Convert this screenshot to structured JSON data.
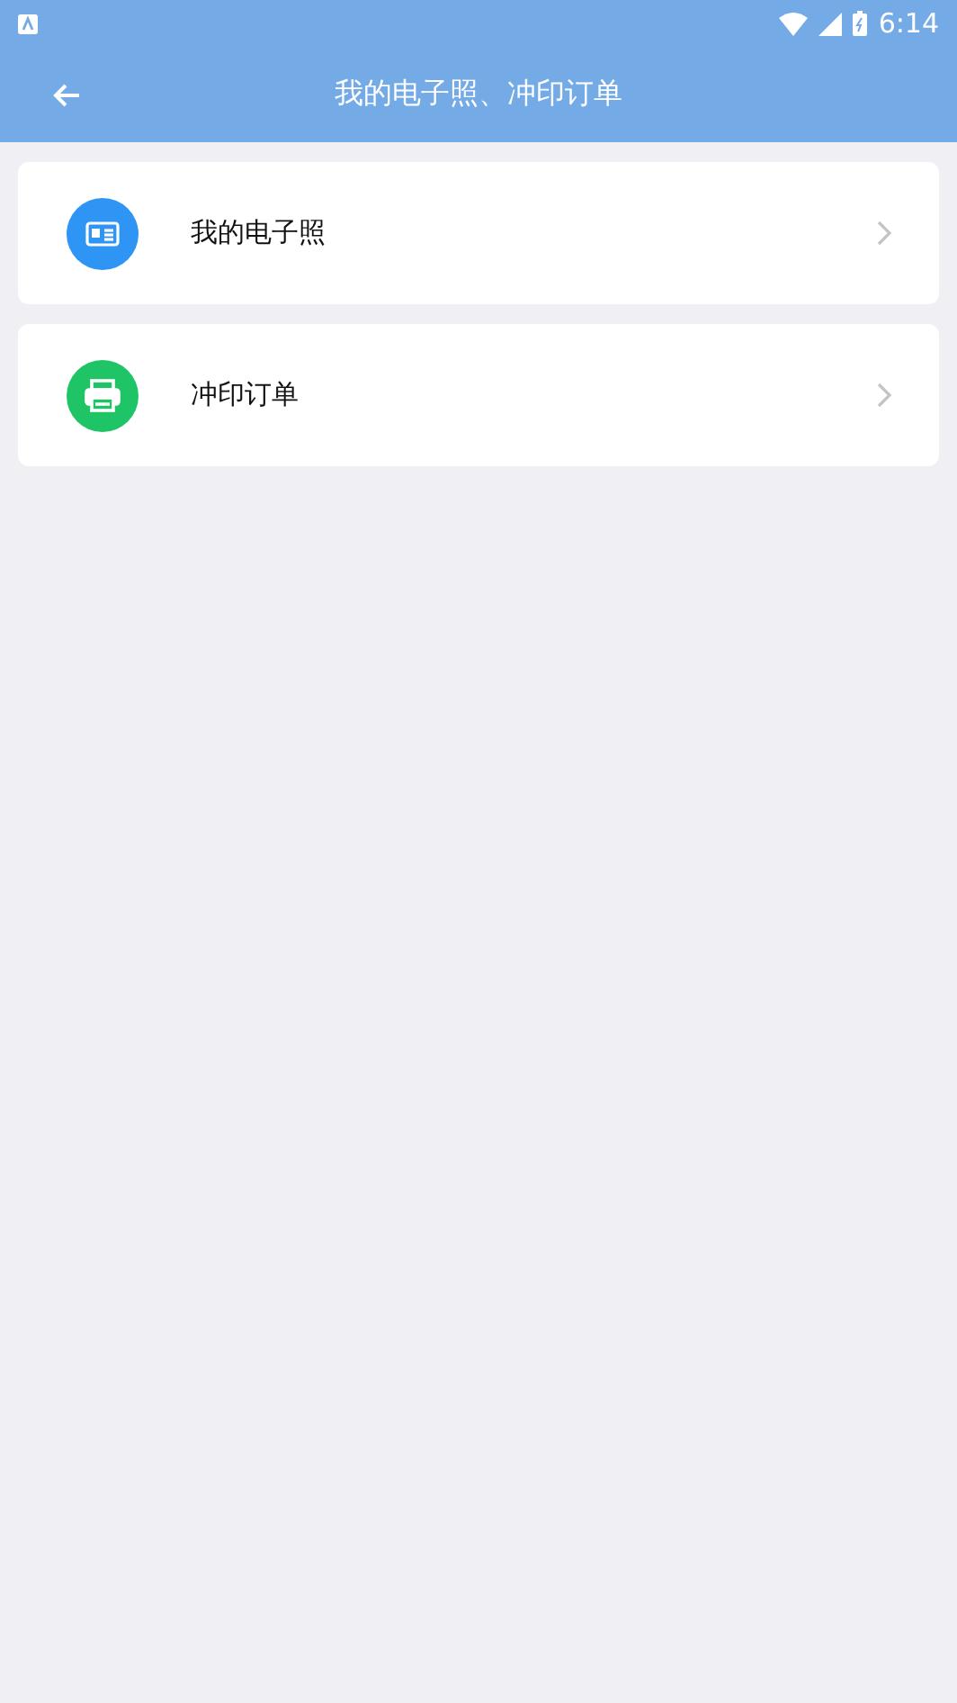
{
  "status_bar": {
    "time": "6:14"
  },
  "header": {
    "title": "我的电子照、冲印订单"
  },
  "items": [
    {
      "label": "我的电子照",
      "kind": "id-card",
      "color": "#2f95f5"
    },
    {
      "label": "冲印订单",
      "kind": "printer",
      "color": "#1fc467"
    }
  ]
}
